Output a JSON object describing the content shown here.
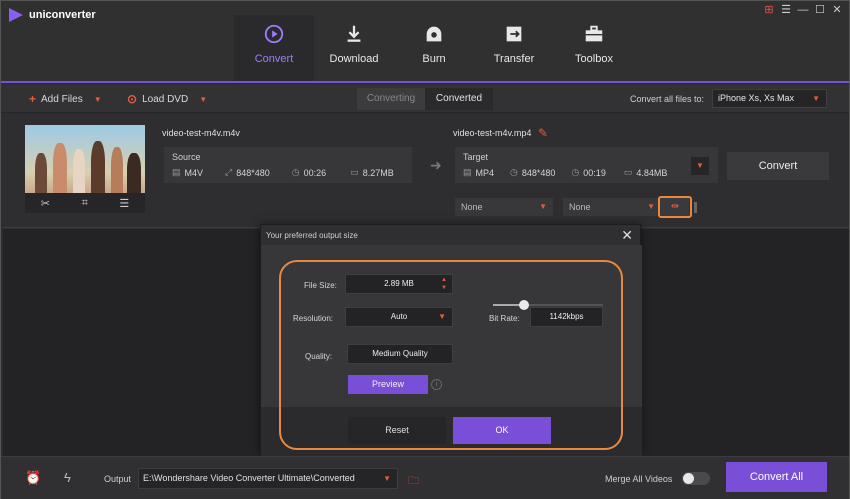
{
  "app": {
    "name": "uniconverter"
  },
  "nav": [
    {
      "label": "Convert",
      "icon": "convert-icon",
      "active": true
    },
    {
      "label": "Download",
      "icon": "download-icon"
    },
    {
      "label": "Burn",
      "icon": "burn-icon"
    },
    {
      "label": "Transfer",
      "icon": "transfer-icon"
    },
    {
      "label": "Toolbox",
      "icon": "toolbox-icon"
    }
  ],
  "toolbar": {
    "add_files": "Add Files",
    "load_dvd": "Load DVD",
    "tab_converting": "Converting",
    "tab_converted": "Converted",
    "convert_all_label": "Convert all files to:",
    "convert_all_value": "iPhone Xs, Xs Max"
  },
  "item": {
    "source_name": "video-test-m4v.m4v",
    "target_name": "video-test-m4v.mp4",
    "source": {
      "heading": "Source",
      "format": "M4V",
      "resolution": "848*480",
      "duration": "00:26",
      "size": "8.27MB"
    },
    "target": {
      "heading": "Target",
      "format": "MP4",
      "resolution": "848*480",
      "duration": "00:19",
      "size": "4.84MB"
    },
    "convert_label": "Convert",
    "subtitle_value": "None",
    "audio_value": "None"
  },
  "dialog": {
    "title": "Your preferred output size",
    "file_size_label": "File Size:",
    "file_size_value": "2.89  MB",
    "resolution_label": "Resolution:",
    "resolution_value": "Auto",
    "quality_label": "Quality:",
    "quality_value": "Medium Quality",
    "bitrate_label": "Bit Rate:",
    "bitrate_value": "1142kbps",
    "slider_fraction": 0.28,
    "preview_label": "Preview",
    "reset_label": "Reset",
    "ok_label": "OK"
  },
  "bottom": {
    "output_label": "Output",
    "output_path": "E:\\Wondershare Video Converter Ultimate\\Converted",
    "merge_label": "Merge All Videos",
    "convert_all_button": "Convert All"
  },
  "colors": {
    "accent": "#7a4fd8",
    "highlight": "#e9893f",
    "icon_red": "#e15c3c"
  }
}
